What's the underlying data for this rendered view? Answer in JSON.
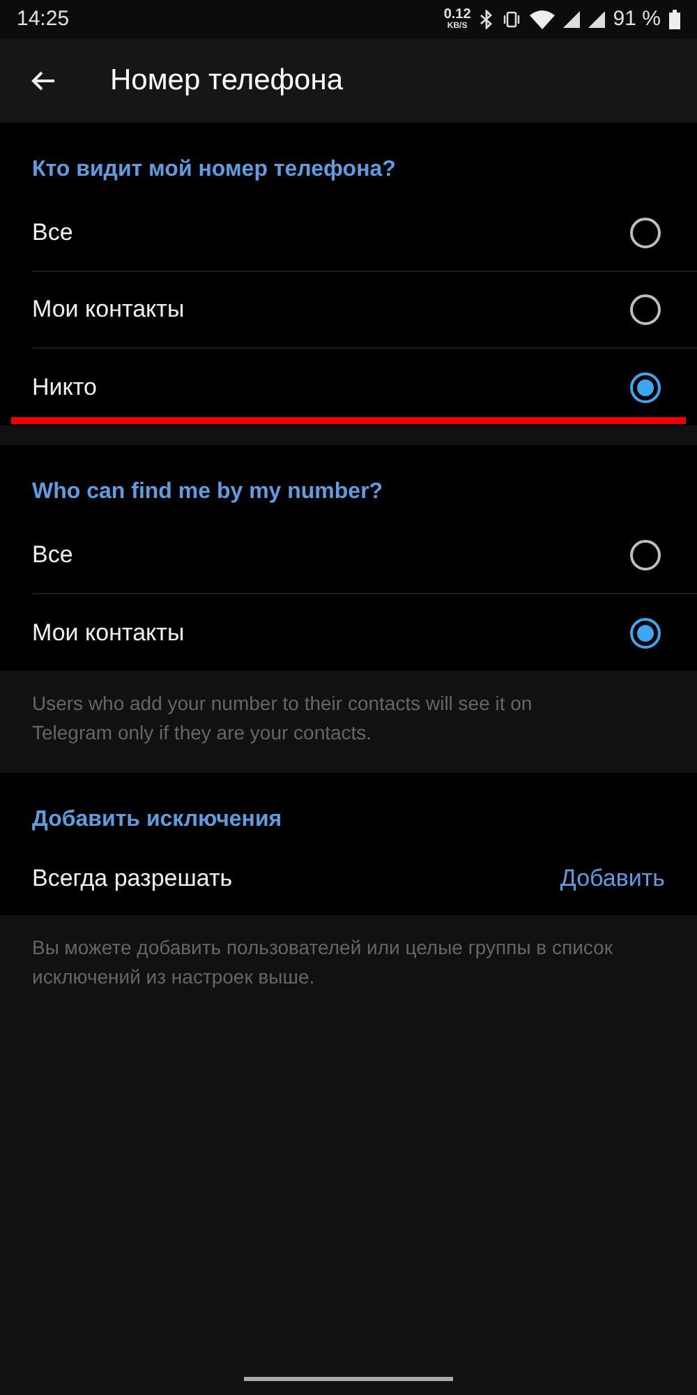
{
  "status_bar": {
    "time": "14:25",
    "speed": "0.12",
    "speed_unit": "KB/S",
    "battery": "91 %"
  },
  "app_bar": {
    "title": "Номер телефона"
  },
  "sections": [
    {
      "header": "Кто видит мой номер телефона?",
      "highlighted": true,
      "options": [
        {
          "label": "Все",
          "selected": false
        },
        {
          "label": "Мои контакты",
          "selected": false
        },
        {
          "label": "Никто",
          "selected": true
        }
      ]
    },
    {
      "header": "Who can find me by my number?",
      "highlighted": false,
      "options": [
        {
          "label": "Все",
          "selected": false
        },
        {
          "label": "Мои контакты",
          "selected": true
        }
      ],
      "info": "Users who add your number to their contacts will see it on Telegram only if they are your contacts."
    }
  ],
  "exceptions": {
    "header": "Добавить исключения",
    "row_label": "Всегда разрешать",
    "action": "Добавить",
    "info": "Вы можете добавить пользователей или целые группы в список исключений из настроек выше."
  }
}
